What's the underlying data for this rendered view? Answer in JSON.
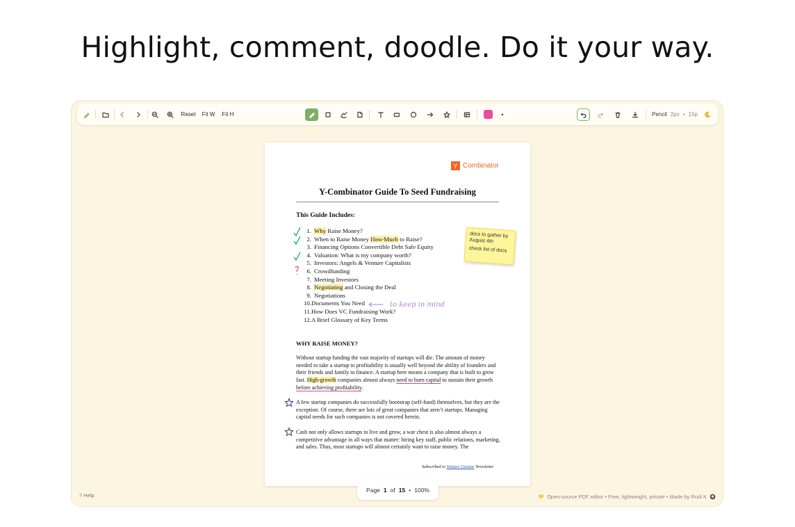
{
  "headline": "Highlight, comment, doodle. Do it your way.",
  "toolbar": {
    "reset": "Reset",
    "fit_width": "Fit W",
    "fit_height": "Fit H",
    "color_swatch": "#e94ba0",
    "tool_name": "Pencil",
    "stroke_size": "2px",
    "font_size": "15p",
    "sep": "•"
  },
  "document": {
    "logo_mark": "Y",
    "logo_text": "Combinator",
    "title": "Y-Combinator Guide To Seed Fundraising",
    "includes_heading": "This Guide Includes:",
    "toc": [
      {
        "num": "1.",
        "parts": [
          {
            "t": "Why",
            "style": "hl"
          },
          {
            "t": " Raise Money?"
          }
        ]
      },
      {
        "num": "2.",
        "parts": [
          {
            "t": "When to Raise Money "
          },
          {
            "t": "How Much",
            "style": "strike"
          },
          {
            "t": " to Raise?"
          }
        ]
      },
      {
        "num": "3.",
        "parts": [
          {
            "t": "Financing Options Convertible Debt Safe Equity"
          }
        ]
      },
      {
        "num": "4.",
        "parts": [
          {
            "t": "Valuation: What is my company worth?"
          }
        ]
      },
      {
        "num": "5.",
        "parts": [
          {
            "t": "Investors: Angels & Venture Capitalists"
          }
        ]
      },
      {
        "num": "6.",
        "parts": [
          {
            "t": "Crowdfunding"
          }
        ]
      },
      {
        "num": "7.",
        "parts": [
          {
            "t": "Meeting Investors"
          }
        ]
      },
      {
        "num": "8.",
        "parts": [
          {
            "t": "Negotiating",
            "style": "strike"
          },
          {
            "t": " and Closing the Deal"
          }
        ]
      },
      {
        "num": "9.",
        "parts": [
          {
            "t": "Negotiations"
          }
        ]
      },
      {
        "num": "10.",
        "parts": [
          {
            "t": "Documents You Need"
          }
        ]
      },
      {
        "num": "11.",
        "parts": [
          {
            "t": "How Does VC Fundraising Work?"
          }
        ]
      },
      {
        "num": "12.",
        "parts": [
          {
            "t": "A Brief Glossary of Key Terms"
          }
        ]
      }
    ],
    "handwritten_note": "to keep in mind",
    "sticky_note_1": "docs to gather by August 4th",
    "sticky_note_2": "check list of docs",
    "section_title": "WHY RAISE MONEY?",
    "para1_a": "Without startup funding the vast majority of startups will die. The amount of money needed to take a startup to profitability is usually well beyond the ability of founders and their friends and family to finance. A startup here means a company that is built to grow fast. ",
    "para1_hl": "High-growth",
    "para1_b": " companies almost always ",
    "para1_u": "need to burn capital",
    "para1_c": " to sustain their growth ",
    "para1_u2": "before achieving profitability",
    "para1_d": ".",
    "para2": "A few startup companies do successfully bootstrap (self-fund) themselves, but they are the exception. Of course, there are lots of great companies that aren’t startups. Managing capital needs for such companies is not covered herein.",
    "para3": "Cash not only allows startups to live and grow, a war chest is also almost always a competitive advantage in all ways that matter: hiring key staff, public relations, marketing, and sales. Thus, most startups will almost certainly want to raise money. The",
    "footer_prefix": "Subscribed to ",
    "footer_link": "Venture Curator",
    "footer_suffix": " Newsletter"
  },
  "pager": {
    "label": "Page",
    "current": "1",
    "of": "of",
    "total": "15",
    "sep": "•",
    "zoom": "100%"
  },
  "help": "? Help",
  "credits": "Open-source PDF editor • Free, lightweight, private • Made by Rudi K"
}
